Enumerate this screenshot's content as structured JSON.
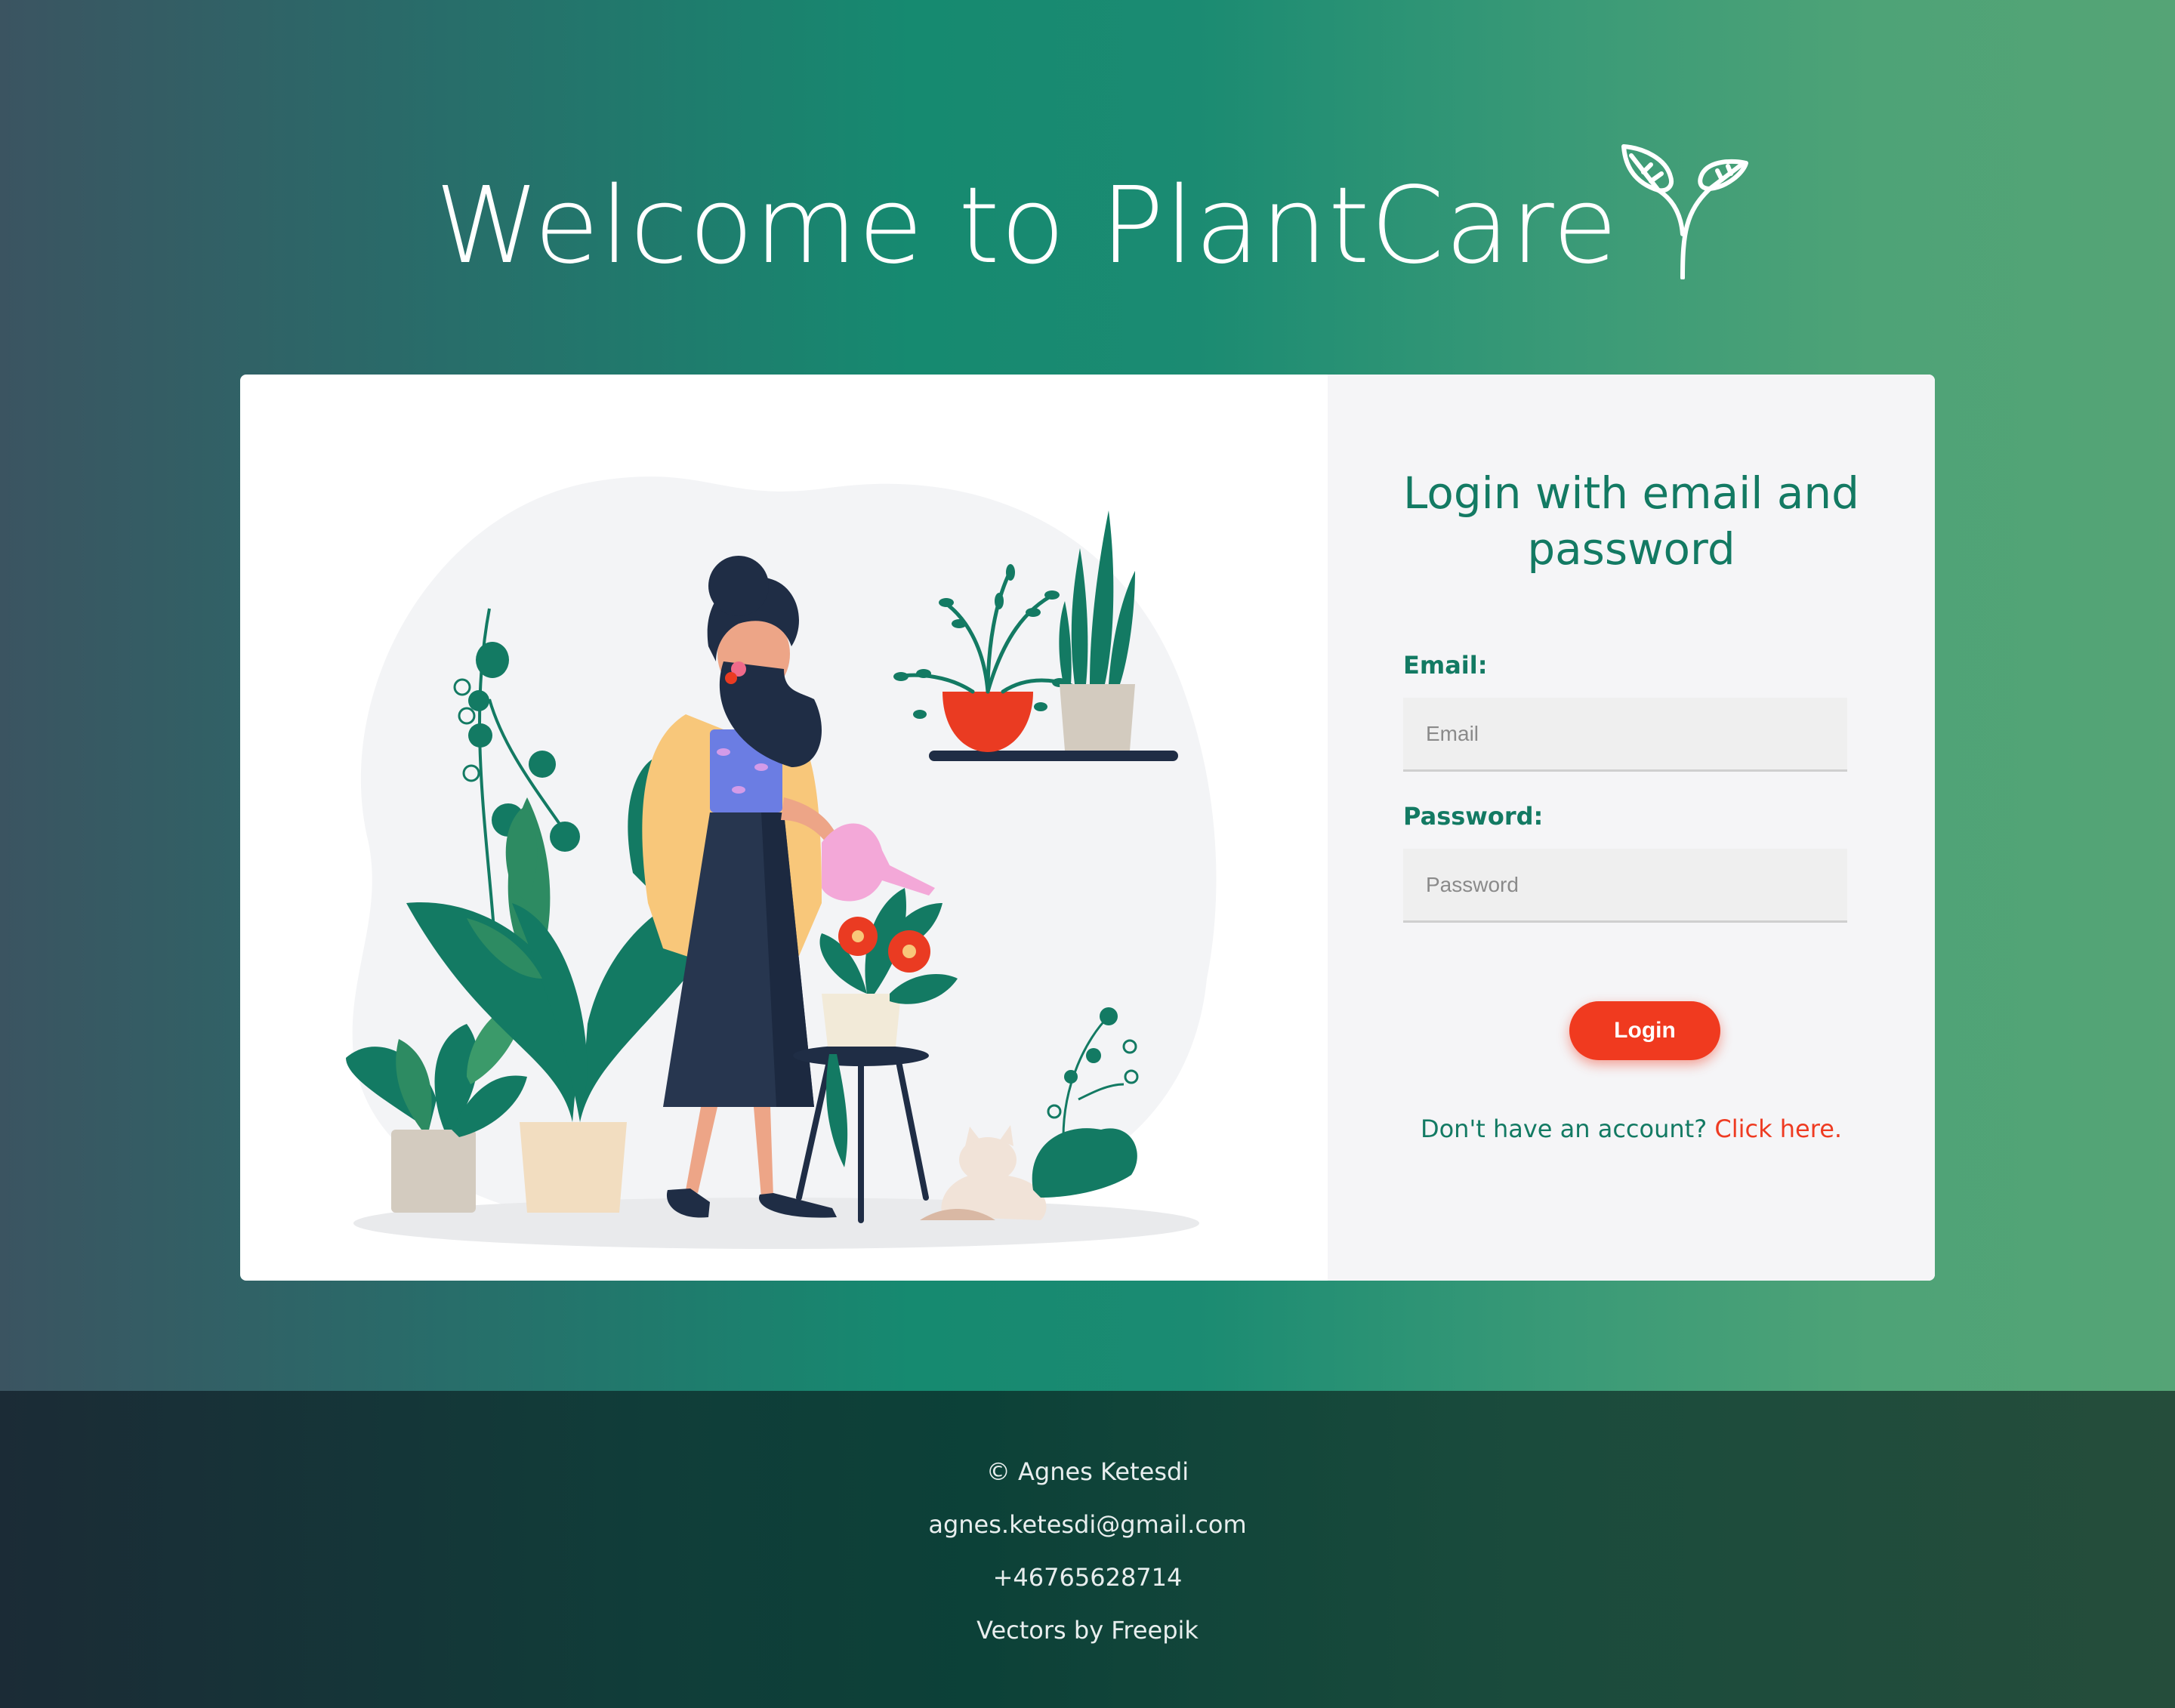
{
  "header": {
    "title": "Welcome to PlantCare",
    "logo_icon": "sprout-icon"
  },
  "illustration": {
    "subject": "woman-watering-plants"
  },
  "login": {
    "heading": "Login with email and password",
    "email_label": "Email:",
    "email_placeholder": "Email",
    "email_value": "",
    "password_label": "Password:",
    "password_placeholder": "Password",
    "password_value": "",
    "button_label": "Login",
    "signup_prompt": "Don't have an account?",
    "signup_link": "Click here."
  },
  "footer": {
    "copyright": "© Agnes Ketesdi",
    "email": "agnes.ketesdi@gmail.com",
    "phone": "+46765628714",
    "credits": "Vectors by Freepik"
  },
  "colors": {
    "accent": "#137a63",
    "button": "#f03a1f",
    "link": "#ee3b22"
  }
}
